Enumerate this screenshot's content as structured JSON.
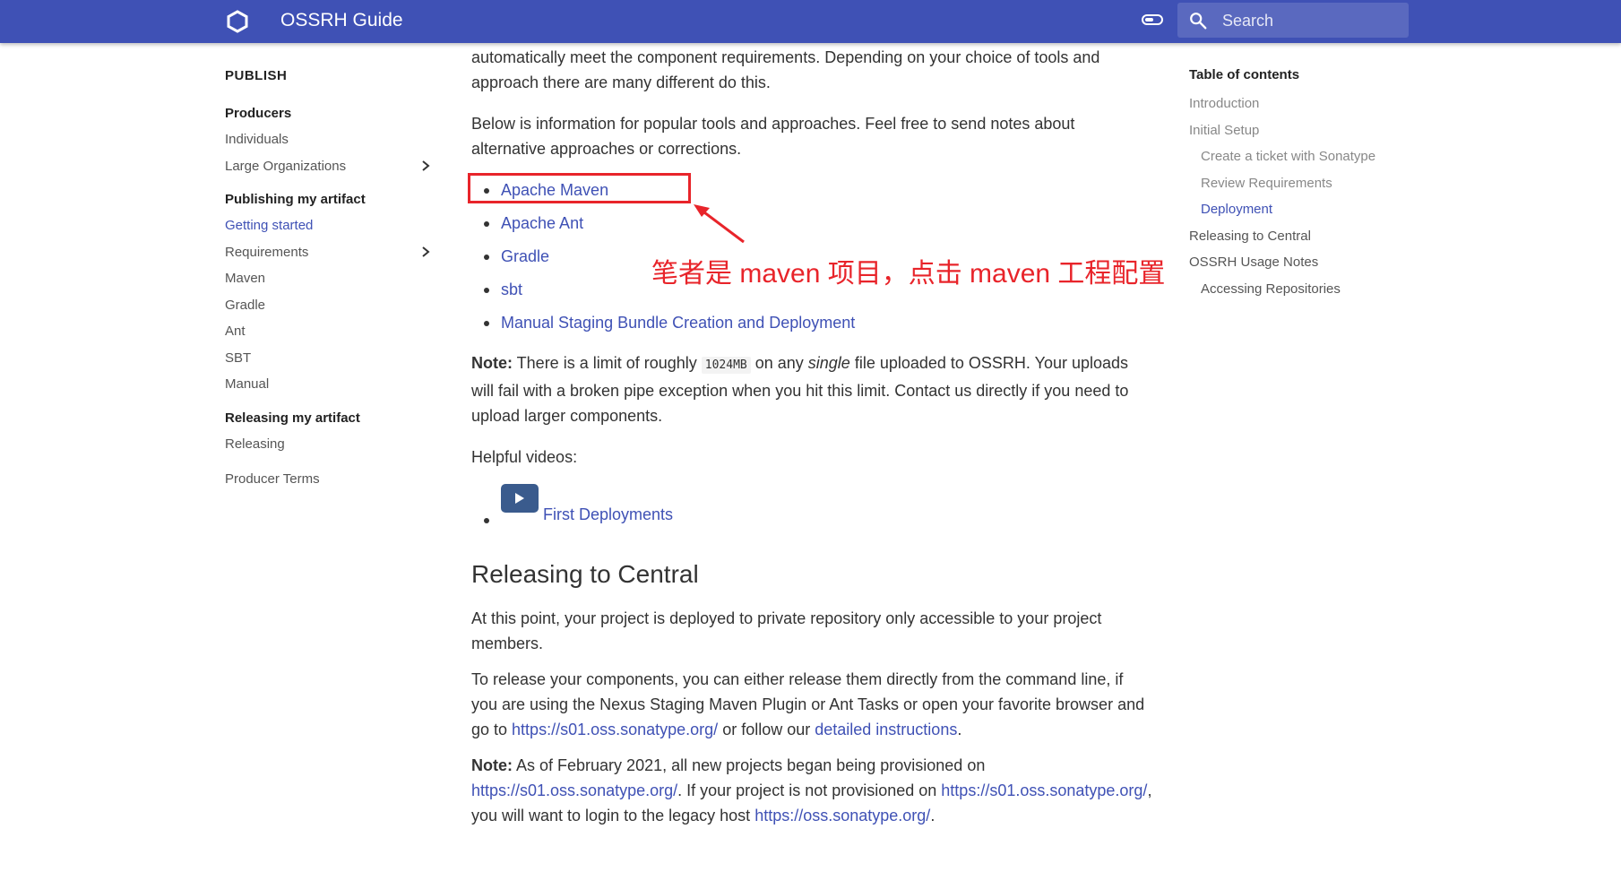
{
  "header": {
    "title": "OSSRH Guide",
    "search_placeholder": "Search",
    "logo_icon": "hexagon-logo-icon",
    "toggle_icon": "toggle-icon",
    "search_icon": "search-icon"
  },
  "sidebar": {
    "section_title": "PUBLISH",
    "groups": [
      {
        "title": "Producers",
        "items": [
          "Individuals",
          "Large Organizations"
        ]
      },
      {
        "title": "Publishing my artifact",
        "items": [
          "Getting started",
          "Requirements",
          "Maven",
          "Gradle",
          "Ant",
          "SBT",
          "Manual"
        ]
      },
      {
        "title": "Releasing my artifact",
        "items": [
          "Releasing"
        ]
      }
    ],
    "footer_item": "Producer Terms",
    "active_item": "Getting started"
  },
  "main": {
    "intro_p1": "automatically meet the component requirements. Depending on your choice of tools and approach there are many different do this.",
    "intro_p2": "Below is information for popular tools and approaches. Feel free to send notes about alternative approaches or corrections.",
    "tools": [
      "Apache Maven",
      "Apache Ant",
      "Gradle",
      "sbt",
      "Manual Staging Bundle Creation and Deployment"
    ],
    "note1": {
      "label": "Note:",
      "t1": " There is a limit of roughly ",
      "code": "1024MB",
      "t2": " on any ",
      "em": "single",
      "t3": " file uploaded to OSSRH. Your uploads will fail with a broken pipe exception when you hit this limit. Contact us directly if you need to upload larger components."
    },
    "helpful_videos": "Helpful videos:",
    "video_link": "First Deployments",
    "section_heading": "Releasing to Central",
    "release_p1": "At this point, your project is deployed to private repository only accessible to your project members.",
    "release_p2": {
      "t1": "To release your components, you can either release them directly from the command line, if you are using the Nexus Staging Maven Plugin or Ant Tasks or open your favorite browser and go to ",
      "link1": "https://s01.oss.sonatype.org/",
      "t2": " or follow our ",
      "link2": "detailed instructions",
      "t3": "."
    },
    "note2": {
      "label": "Note:",
      "t1": " As of February 2021, all new projects began being provisioned on ",
      "link1": "https://s01.oss.sonatype.org/",
      "t2": ". If your project is not provisioned on ",
      "link2": "https://s01.oss.sonatype.org/",
      "t3": ", you will want to login to the legacy host ",
      "link3": "https://oss.sonatype.org/",
      "t4": "."
    }
  },
  "toc": {
    "title": "Table of contents",
    "items": [
      "Introduction",
      "Initial Setup",
      "Create a ticket with Sonatype",
      "Review Requirements",
      "Deployment",
      "Releasing to Central",
      "OSSRH Usage Notes",
      "Accessing Repositories"
    ]
  },
  "annotation": {
    "text": "笔者是 maven 项目，点击 maven 工程配置",
    "color": "#e8242a"
  },
  "colors": {
    "header_bg": "#3f51b5",
    "link": "#3f51b5"
  }
}
